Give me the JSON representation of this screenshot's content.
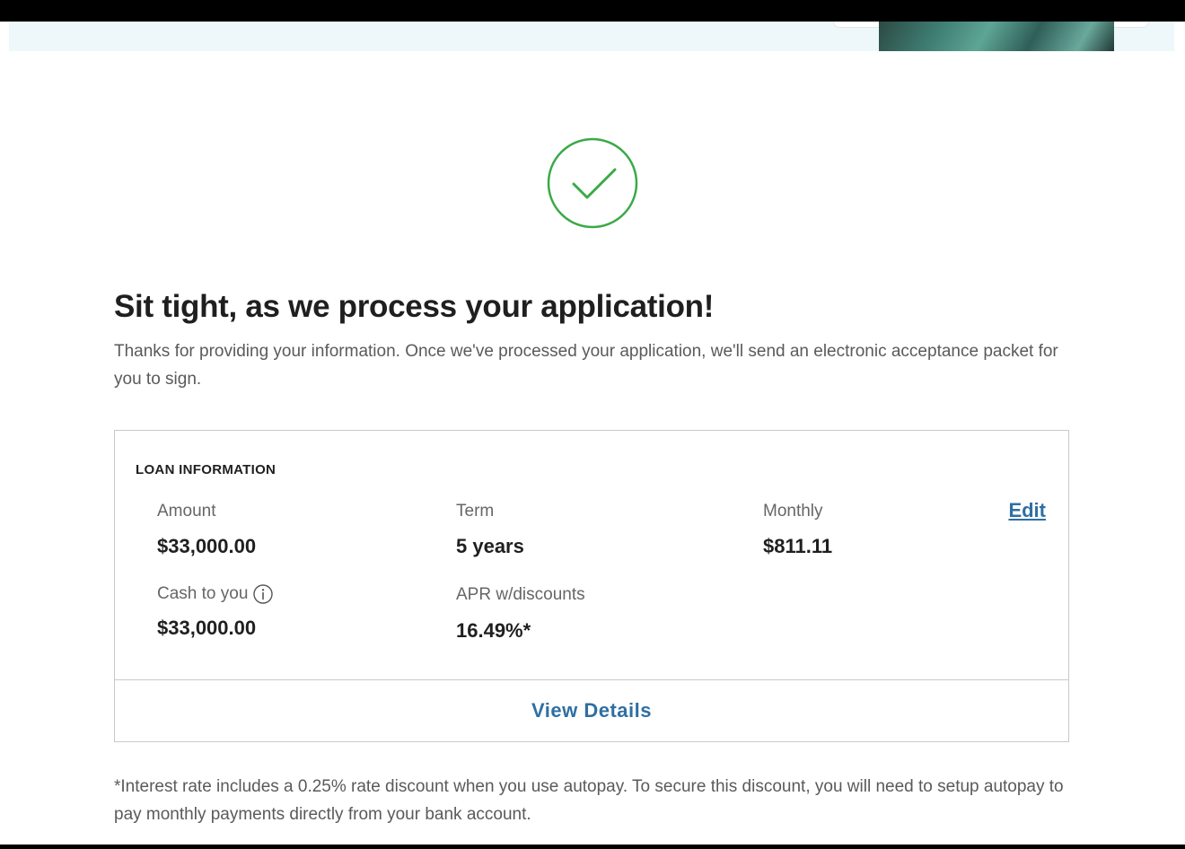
{
  "confirmation": {
    "title": "Sit tight, as we process your application!",
    "subtitle": "Thanks for providing your information. Once we've processed your application, we'll send an electronic acceptance packet for you to sign."
  },
  "loan_card": {
    "heading": "LOAN INFORMATION",
    "amount": {
      "label": "Amount",
      "value": "$33,000.00"
    },
    "term": {
      "label": "Term",
      "value": "5 years"
    },
    "monthly": {
      "label": "Monthly",
      "value": "$811.11"
    },
    "cash_to_you": {
      "label": "Cash to you",
      "value": "$33,000.00"
    },
    "apr": {
      "label": "APR w/discounts",
      "value": "16.49%*"
    },
    "edit_label": "Edit",
    "view_details_label": "View  Details"
  },
  "footnote": "*Interest rate includes a 0.25% rate discount when you use autopay. To secure this discount, you will need to setup autopay to pay monthly payments directly from your bank account.",
  "icons": {
    "success": "check-circle-icon",
    "info": "info-icon"
  },
  "colors": {
    "success_green": "#3aaa47",
    "link_blue": "#2f6fa3",
    "border_gray": "#c9c9c9",
    "header_tint": "#eef8fa"
  }
}
